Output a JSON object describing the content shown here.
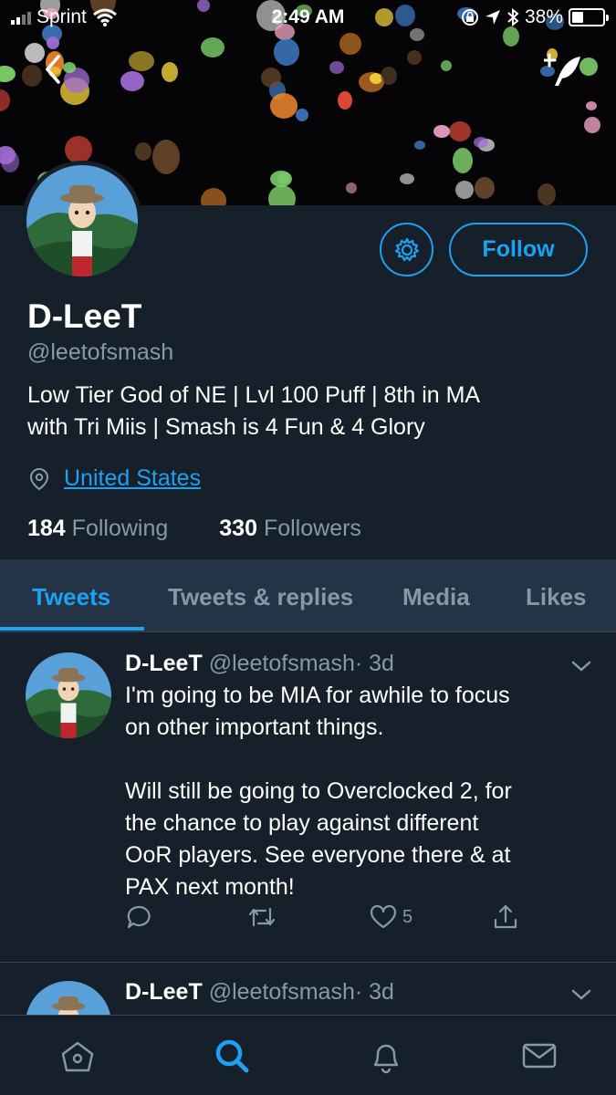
{
  "status_bar": {
    "carrier": "Sprint",
    "time": "2:49 AM",
    "battery_percent": "38%",
    "battery_level": 0.38
  },
  "icons": {
    "back": "chevron-left-icon",
    "compose": "compose-tweet-icon",
    "settings": "gear-icon",
    "location": "location-pin-icon",
    "reply": "reply-icon",
    "retweet": "retweet-icon",
    "like": "heart-icon",
    "share": "share-icon",
    "home": "home-icon",
    "search": "search-icon",
    "notifications": "bell-icon",
    "messages": "mail-icon"
  },
  "colors": {
    "background": "#15202b",
    "accent": "#1da1f2",
    "secondary_text": "#8899a6",
    "tab_bar": "#243447",
    "divider": "#38444d"
  },
  "profile": {
    "display_name": "D-LeeT",
    "handle": "@leetofsmash",
    "bio_line1": "Low Tier God of NE | Lvl 100 Puff | 8th in MA",
    "bio_line2": "with Tri Miis | Smash is 4 Fun & 4 Glory",
    "location": "United States",
    "following_count": "184",
    "following_label": "Following",
    "followers_count": "330",
    "followers_label": "Followers",
    "follow_label": "Follow"
  },
  "tabs": [
    {
      "label": "Tweets",
      "active": true
    },
    {
      "label": "Tweets & replies",
      "active": false
    },
    {
      "label": "Media",
      "active": false
    },
    {
      "label": "Likes",
      "active": false
    }
  ],
  "tweets": [
    {
      "name": "D-LeeT",
      "handle": "@leetofsmash",
      "time": "· 3d",
      "lines": [
        "I'm going to be MIA for awhile to focus",
        "on other important things.",
        "",
        "Will still be going to Overclocked 2, for",
        "the chance to play against different",
        "OoR players. See everyone there & at",
        "PAX next month!"
      ],
      "like_count": "5"
    },
    {
      "name": "D-LeeT",
      "handle": "@leetofsmash",
      "time": "· 3d"
    }
  ]
}
